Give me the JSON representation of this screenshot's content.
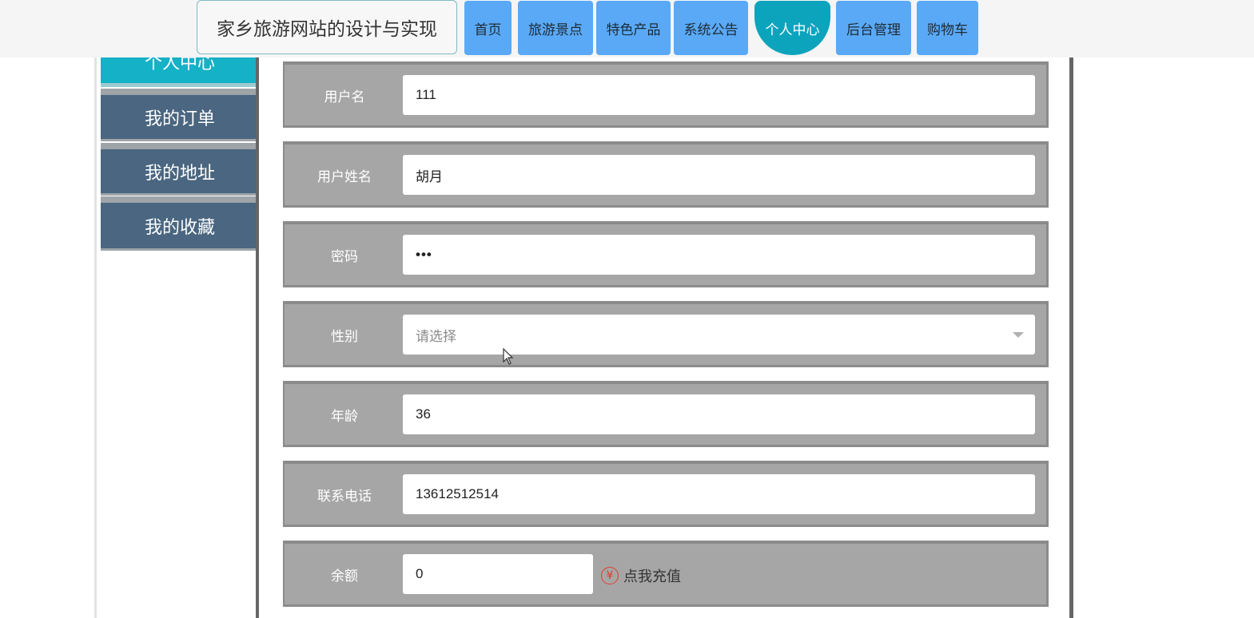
{
  "site": {
    "title": "家乡旅游网站的设计与实现"
  },
  "nav": [
    {
      "label": "首页"
    },
    {
      "label": "旅游景点"
    },
    {
      "label": "特色产品"
    },
    {
      "label": "系统公告"
    },
    {
      "label": "个人中心",
      "active": true
    },
    {
      "label": "后台管理"
    },
    {
      "label": "购物车"
    }
  ],
  "sidebar": {
    "items": [
      {
        "label": "个人中心",
        "active": true
      },
      {
        "label": "我的订单"
      },
      {
        "label": "我的地址"
      },
      {
        "label": "我的收藏"
      }
    ]
  },
  "form": {
    "username": {
      "label": "用户名",
      "value": "111"
    },
    "realname": {
      "label": "用户姓名",
      "value": "胡月"
    },
    "password": {
      "label": "密码",
      "value": "•••"
    },
    "gender": {
      "label": "性别",
      "placeholder": "请选择"
    },
    "age": {
      "label": "年龄",
      "value": "36"
    },
    "phone": {
      "label": "联系电话",
      "value": "13612512514"
    },
    "balance": {
      "label": "余额",
      "value": "0",
      "recharge_label": "点我充值",
      "currency_symbol": "¥"
    }
  },
  "colors": {
    "nav_button": "#5aa9f6",
    "nav_active": "#0ca4bc",
    "sidebar_item": "#4a6680",
    "sidebar_active": "#15b1c6",
    "form_row": "#a6a6a6",
    "recharge_icon": "#e53a2f"
  },
  "icons": {
    "recharge": "yen-icon",
    "select": "chevron-down-icon",
    "pointer": "mouse-pointer-icon"
  }
}
